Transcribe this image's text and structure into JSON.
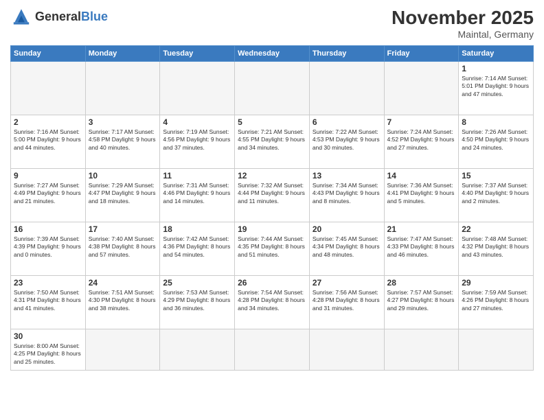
{
  "logo": {
    "text_general": "General",
    "text_blue": "Blue"
  },
  "header": {
    "month": "November 2025",
    "location": "Maintal, Germany"
  },
  "weekdays": [
    "Sunday",
    "Monday",
    "Tuesday",
    "Wednesday",
    "Thursday",
    "Friday",
    "Saturday"
  ],
  "weeks": [
    [
      {
        "day": "",
        "info": ""
      },
      {
        "day": "",
        "info": ""
      },
      {
        "day": "",
        "info": ""
      },
      {
        "day": "",
        "info": ""
      },
      {
        "day": "",
        "info": ""
      },
      {
        "day": "",
        "info": ""
      },
      {
        "day": "1",
        "info": "Sunrise: 7:14 AM\nSunset: 5:01 PM\nDaylight: 9 hours and 47 minutes."
      }
    ],
    [
      {
        "day": "2",
        "info": "Sunrise: 7:16 AM\nSunset: 5:00 PM\nDaylight: 9 hours and 44 minutes."
      },
      {
        "day": "3",
        "info": "Sunrise: 7:17 AM\nSunset: 4:58 PM\nDaylight: 9 hours and 40 minutes."
      },
      {
        "day": "4",
        "info": "Sunrise: 7:19 AM\nSunset: 4:56 PM\nDaylight: 9 hours and 37 minutes."
      },
      {
        "day": "5",
        "info": "Sunrise: 7:21 AM\nSunset: 4:55 PM\nDaylight: 9 hours and 34 minutes."
      },
      {
        "day": "6",
        "info": "Sunrise: 7:22 AM\nSunset: 4:53 PM\nDaylight: 9 hours and 30 minutes."
      },
      {
        "day": "7",
        "info": "Sunrise: 7:24 AM\nSunset: 4:52 PM\nDaylight: 9 hours and 27 minutes."
      },
      {
        "day": "8",
        "info": "Sunrise: 7:26 AM\nSunset: 4:50 PM\nDaylight: 9 hours and 24 minutes."
      }
    ],
    [
      {
        "day": "9",
        "info": "Sunrise: 7:27 AM\nSunset: 4:49 PM\nDaylight: 9 hours and 21 minutes."
      },
      {
        "day": "10",
        "info": "Sunrise: 7:29 AM\nSunset: 4:47 PM\nDaylight: 9 hours and 18 minutes."
      },
      {
        "day": "11",
        "info": "Sunrise: 7:31 AM\nSunset: 4:46 PM\nDaylight: 9 hours and 14 minutes."
      },
      {
        "day": "12",
        "info": "Sunrise: 7:32 AM\nSunset: 4:44 PM\nDaylight: 9 hours and 11 minutes."
      },
      {
        "day": "13",
        "info": "Sunrise: 7:34 AM\nSunset: 4:43 PM\nDaylight: 9 hours and 8 minutes."
      },
      {
        "day": "14",
        "info": "Sunrise: 7:36 AM\nSunset: 4:41 PM\nDaylight: 9 hours and 5 minutes."
      },
      {
        "day": "15",
        "info": "Sunrise: 7:37 AM\nSunset: 4:40 PM\nDaylight: 9 hours and 2 minutes."
      }
    ],
    [
      {
        "day": "16",
        "info": "Sunrise: 7:39 AM\nSunset: 4:39 PM\nDaylight: 9 hours and 0 minutes."
      },
      {
        "day": "17",
        "info": "Sunrise: 7:40 AM\nSunset: 4:38 PM\nDaylight: 8 hours and 57 minutes."
      },
      {
        "day": "18",
        "info": "Sunrise: 7:42 AM\nSunset: 4:36 PM\nDaylight: 8 hours and 54 minutes."
      },
      {
        "day": "19",
        "info": "Sunrise: 7:44 AM\nSunset: 4:35 PM\nDaylight: 8 hours and 51 minutes."
      },
      {
        "day": "20",
        "info": "Sunrise: 7:45 AM\nSunset: 4:34 PM\nDaylight: 8 hours and 48 minutes."
      },
      {
        "day": "21",
        "info": "Sunrise: 7:47 AM\nSunset: 4:33 PM\nDaylight: 8 hours and 46 minutes."
      },
      {
        "day": "22",
        "info": "Sunrise: 7:48 AM\nSunset: 4:32 PM\nDaylight: 8 hours and 43 minutes."
      }
    ],
    [
      {
        "day": "23",
        "info": "Sunrise: 7:50 AM\nSunset: 4:31 PM\nDaylight: 8 hours and 41 minutes."
      },
      {
        "day": "24",
        "info": "Sunrise: 7:51 AM\nSunset: 4:30 PM\nDaylight: 8 hours and 38 minutes."
      },
      {
        "day": "25",
        "info": "Sunrise: 7:53 AM\nSunset: 4:29 PM\nDaylight: 8 hours and 36 minutes."
      },
      {
        "day": "26",
        "info": "Sunrise: 7:54 AM\nSunset: 4:28 PM\nDaylight: 8 hours and 34 minutes."
      },
      {
        "day": "27",
        "info": "Sunrise: 7:56 AM\nSunset: 4:28 PM\nDaylight: 8 hours and 31 minutes."
      },
      {
        "day": "28",
        "info": "Sunrise: 7:57 AM\nSunset: 4:27 PM\nDaylight: 8 hours and 29 minutes."
      },
      {
        "day": "29",
        "info": "Sunrise: 7:59 AM\nSunset: 4:26 PM\nDaylight: 8 hours and 27 minutes."
      }
    ],
    [
      {
        "day": "30",
        "info": "Sunrise: 8:00 AM\nSunset: 4:25 PM\nDaylight: 8 hours and 25 minutes."
      },
      {
        "day": "",
        "info": ""
      },
      {
        "day": "",
        "info": ""
      },
      {
        "day": "",
        "info": ""
      },
      {
        "day": "",
        "info": ""
      },
      {
        "day": "",
        "info": ""
      },
      {
        "day": "",
        "info": ""
      }
    ]
  ]
}
